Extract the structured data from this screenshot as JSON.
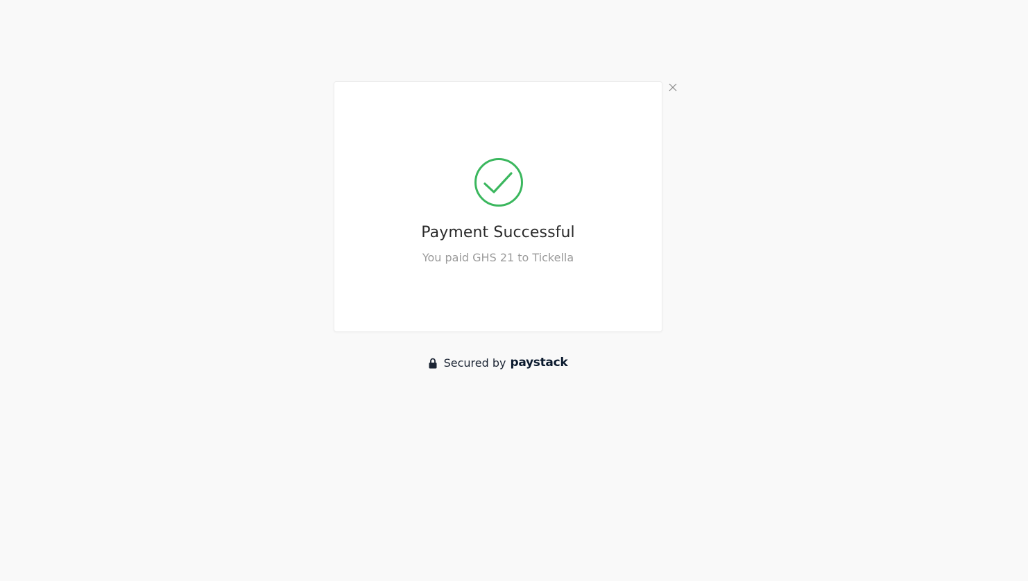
{
  "modal": {
    "title": "Payment Successful",
    "subtitle": "You paid GHS 21 to Tickella",
    "success_color": "#3bb75e"
  },
  "close": {
    "icon": "close-icon"
  },
  "footer": {
    "secured_label": "Secured by",
    "brand": "paystack",
    "icon": "lock-icon"
  }
}
